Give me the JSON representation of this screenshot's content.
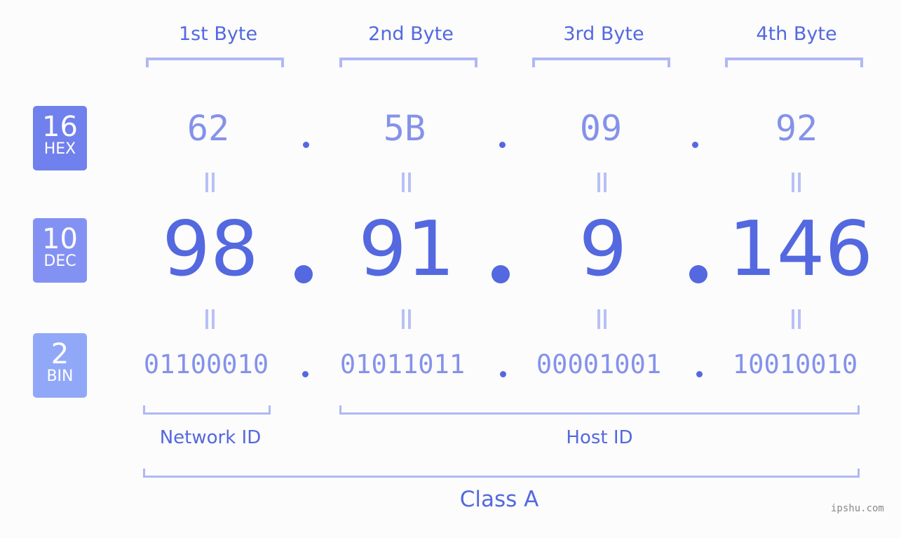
{
  "headers": [
    "1st Byte",
    "2nd Byte",
    "3rd Byte",
    "4th Byte"
  ],
  "badges": {
    "hex": {
      "base": "16",
      "label": "HEX",
      "color": "#7080ec"
    },
    "dec": {
      "base": "10",
      "label": "DEC",
      "color": "#8392f2"
    },
    "bin": {
      "base": "2",
      "label": "BIN",
      "color": "#91a8f8"
    }
  },
  "hex": [
    "62",
    "5B",
    "09",
    "92"
  ],
  "dec": [
    "98",
    "91",
    "9",
    "146"
  ],
  "bin": [
    "01100010",
    "01011011",
    "00001001",
    "10010010"
  ],
  "equals": "=",
  "network_label": "Network ID",
  "host_label": "Host ID",
  "class_label": "Class A",
  "watermark": "ipshu.com"
}
